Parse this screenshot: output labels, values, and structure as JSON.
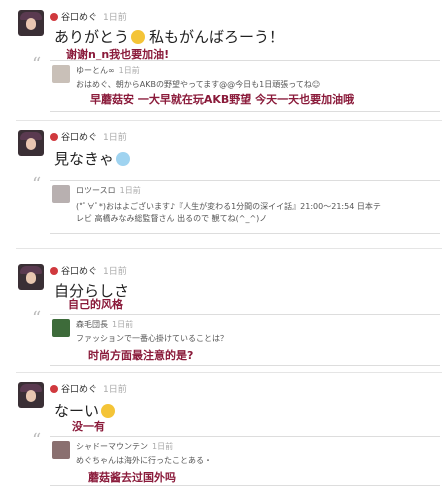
{
  "posts": [
    {
      "author": "谷口めぐ",
      "time": "1日前",
      "text": "ありがとう",
      "text2": "私もがんばろーう！",
      "translation": "谢谢n_n我也要加油!",
      "reply": {
        "author": "ゆーとん∞",
        "time": "1日前",
        "text": "おはめぐ、朝からAKBの野望やってます@@今日も1日頑張ってね☺",
        "translation": "早蘑菇安 一大早就在玩AKB野望 今天一天也要加油哦"
      }
    },
    {
      "author": "谷口めぐ",
      "time": "1日前",
      "text": "見なきゃ",
      "reply": {
        "author": "ロツースロ",
        "time": "1日前",
        "text": "(*ﾟ∀ﾟ*)おはよございます♪『人生が変わる1分間の深イイ話』21:00〜21:54 日本テ",
        "text2": "レビ 高橋みなみ総監督さん 出るので 観てね(^_^)ノ"
      }
    },
    {
      "author": "谷口めぐ",
      "time": "1日前",
      "text": "自分らしさ",
      "translation": "自己的风格",
      "reply": {
        "author": "森毛団長",
        "time": "1日前",
        "text": "ファッションで一番心掛けていることは？",
        "translation": "时尚方面最注意的是?"
      }
    },
    {
      "author": "谷口めぐ",
      "time": "1日前",
      "text": "なーい",
      "translation": "没一有",
      "reply": {
        "author": "シャドーマウンテン",
        "time": "1日前",
        "text": "めぐちゃんは海外に行ったことある・",
        "translation": "蘑菇酱去过国外吗"
      }
    }
  ],
  "colors": {
    "badge": "#d0393e",
    "translation": "#8a1a3a"
  }
}
